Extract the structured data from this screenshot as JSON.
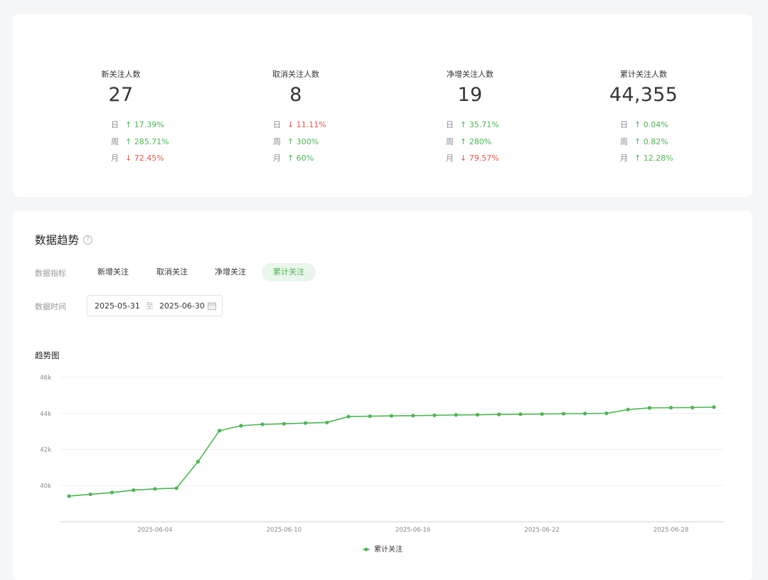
{
  "stats": [
    {
      "title": "新关注人数",
      "value": "27",
      "rows": [
        {
          "label": "日",
          "dir": "up",
          "value": "17.39%"
        },
        {
          "label": "周",
          "dir": "up",
          "value": "285.71%"
        },
        {
          "label": "月",
          "dir": "down",
          "value": "72.45%"
        }
      ]
    },
    {
      "title": "取消关注人数",
      "value": "8",
      "rows": [
        {
          "label": "日",
          "dir": "down",
          "value": "11.11%"
        },
        {
          "label": "周",
          "dir": "up",
          "value": "300%"
        },
        {
          "label": "月",
          "dir": "up",
          "value": "60%"
        }
      ]
    },
    {
      "title": "净增关注人数",
      "value": "19",
      "rows": [
        {
          "label": "日",
          "dir": "up",
          "value": "35.71%"
        },
        {
          "label": "周",
          "dir": "up",
          "value": "280%"
        },
        {
          "label": "月",
          "dir": "down",
          "value": "79.57%"
        }
      ]
    },
    {
      "title": "累计关注人数",
      "value": "44,355",
      "rows": [
        {
          "label": "日",
          "dir": "up",
          "value": "0.04%"
        },
        {
          "label": "周",
          "dir": "up",
          "value": "0.82%"
        },
        {
          "label": "月",
          "dir": "up",
          "value": "12.28%"
        }
      ]
    }
  ],
  "trend": {
    "title": "数据趋势",
    "help_icon": "question-circle-icon",
    "metric_label": "数据指标",
    "metrics": [
      "新增关注",
      "取消关注",
      "净增关注",
      "累计关注"
    ],
    "active_metric": "累计关注",
    "time_label": "数据时间",
    "date_start": "2025-05-31",
    "date_sep": "至",
    "date_end": "2025-06-30",
    "calendar_icon": "calendar-icon",
    "chart_title": "趋势图"
  },
  "colors": {
    "accent": "#4cb552",
    "down": "#e5534b",
    "active_tab_bg": "#eaf6ec"
  },
  "chart_data": {
    "type": "line",
    "title": "趋势图",
    "xlabel": "",
    "ylabel": "",
    "x": [
      "2025-05-31",
      "2025-06-01",
      "2025-06-02",
      "2025-06-03",
      "2025-06-04",
      "2025-06-05",
      "2025-06-06",
      "2025-06-07",
      "2025-06-08",
      "2025-06-09",
      "2025-06-10",
      "2025-06-11",
      "2025-06-12",
      "2025-06-13",
      "2025-06-14",
      "2025-06-15",
      "2025-06-16",
      "2025-06-17",
      "2025-06-18",
      "2025-06-19",
      "2025-06-20",
      "2025-06-21",
      "2025-06-22",
      "2025-06-23",
      "2025-06-24",
      "2025-06-25",
      "2025-06-26",
      "2025-06-27",
      "2025-06-28",
      "2025-06-29",
      "2025-06-30"
    ],
    "x_ticks": [
      "2025-06-04",
      "2025-06-10",
      "2025-06-16",
      "2025-06-22",
      "2025-06-28"
    ],
    "y_ticks": [
      40000,
      42000,
      44000,
      46000
    ],
    "y_tick_labels": [
      "40k",
      "42k",
      "44k",
      "46k"
    ],
    "ylim": [
      38000,
      46000
    ],
    "grid": true,
    "legend": "bottom-center",
    "series": [
      {
        "name": "累计关注",
        "color": "#4cb552",
        "values": [
          39420,
          39520,
          39620,
          39750,
          39820,
          39860,
          41330,
          43050,
          43320,
          43400,
          43430,
          43470,
          43500,
          43830,
          43850,
          43870,
          43880,
          43900,
          43920,
          43930,
          43950,
          43960,
          43970,
          43990,
          44000,
          44010,
          44220,
          44310,
          44320,
          44330,
          44355
        ]
      }
    ]
  }
}
